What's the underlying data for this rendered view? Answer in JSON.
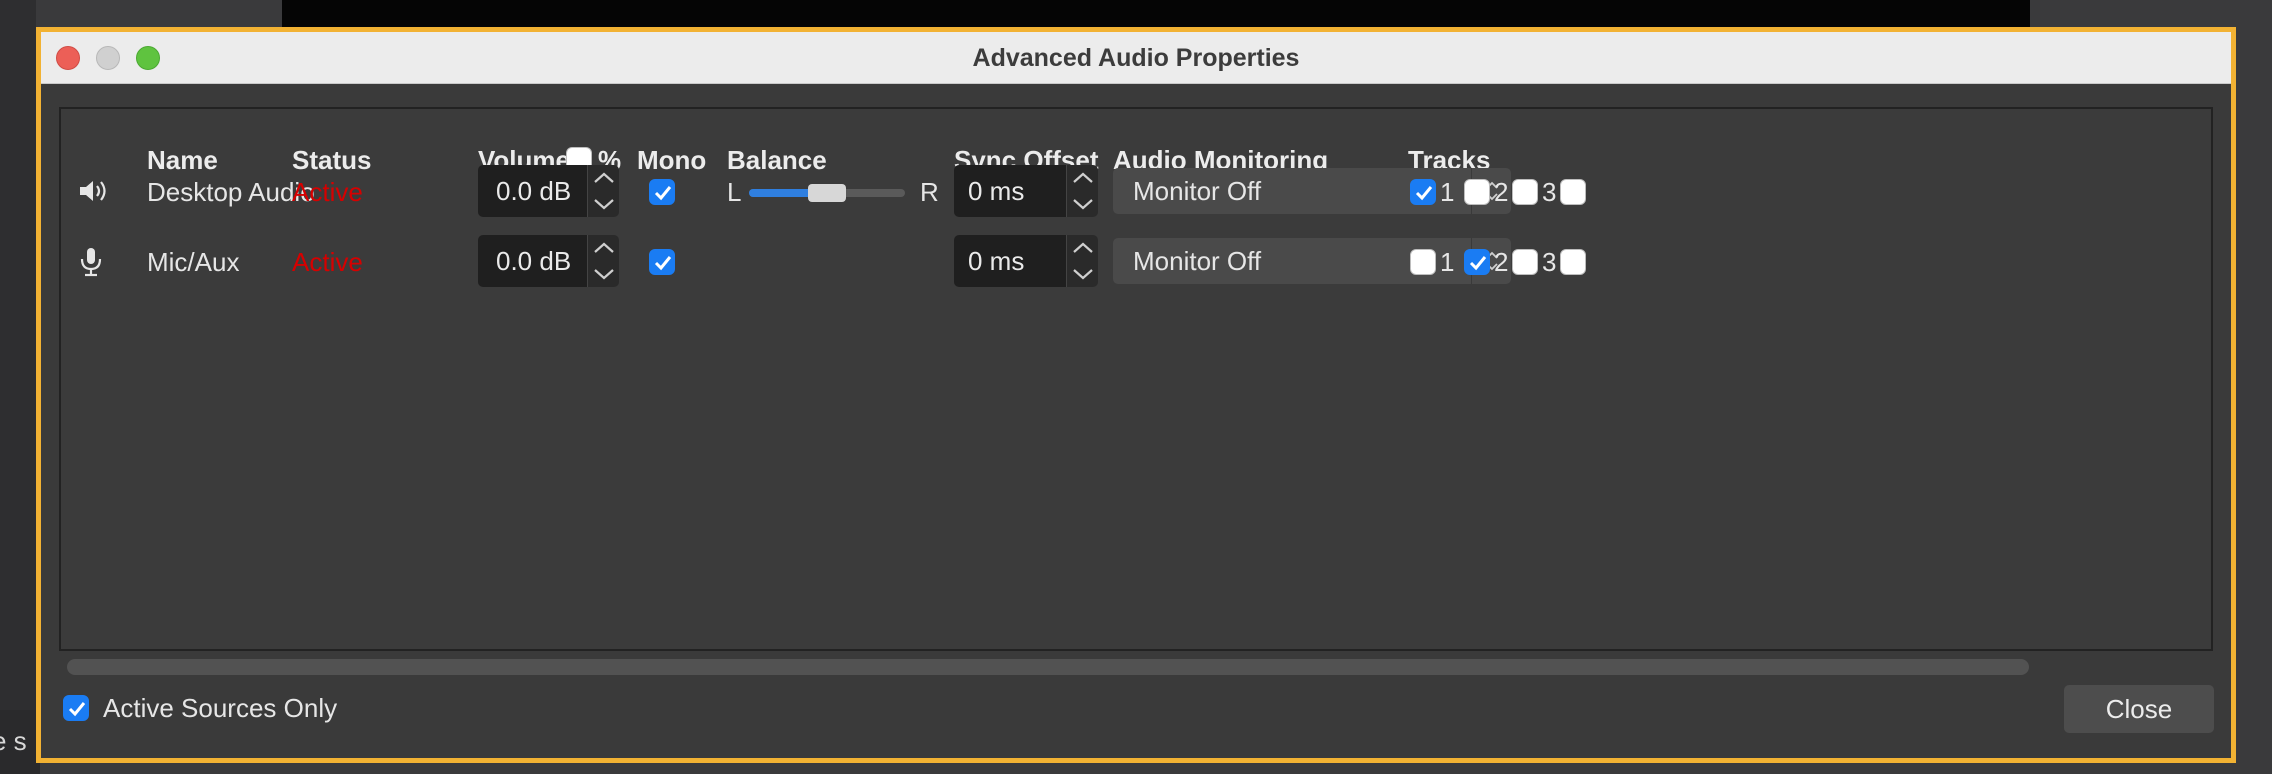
{
  "background": {
    "partial_text": "e s"
  },
  "window": {
    "title": "Advanced Audio Properties",
    "accent_border_color": "#f2b233"
  },
  "headers": {
    "name": "Name",
    "status": "Status",
    "volume": "Volume",
    "volume_percent": "%",
    "mono": "Mono",
    "balance": "Balance",
    "sync_offset": "Sync Offset",
    "audio_monitoring": "Audio Monitoring",
    "tracks": "Tracks"
  },
  "volume_percent_checked": false,
  "balance_labels": {
    "left": "L",
    "right": "R"
  },
  "rows": [
    {
      "icon": "speaker-icon",
      "name": "Desktop Audio",
      "status": "Active",
      "volume": "0.0 dB",
      "mono": true,
      "balance_fraction": 0.5,
      "sync_offset": "0 ms",
      "monitoring": "Monitor Off",
      "tracks": [
        {
          "label": "1",
          "checked": true
        },
        {
          "label": "2",
          "checked": false
        },
        {
          "label": "3",
          "checked": false
        },
        {
          "label": "",
          "checked": false
        }
      ]
    },
    {
      "icon": "microphone-icon",
      "name": "Mic/Aux",
      "status": "Active",
      "volume": "0.0 dB",
      "mono": true,
      "sync_offset": "0 ms",
      "monitoring": "Monitor Off",
      "tracks": [
        {
          "label": "1",
          "checked": false
        },
        {
          "label": "2",
          "checked": true
        },
        {
          "label": "3",
          "checked": false
        },
        {
          "label": "",
          "checked": false
        }
      ]
    }
  ],
  "footer": {
    "active_sources_only": "Active Sources Only",
    "active_sources_only_checked": true,
    "close": "Close"
  },
  "colors": {
    "status_active": "#d60000",
    "checkbox_checked": "#1a7cf3",
    "slider_fill": "#2f7fe0"
  }
}
